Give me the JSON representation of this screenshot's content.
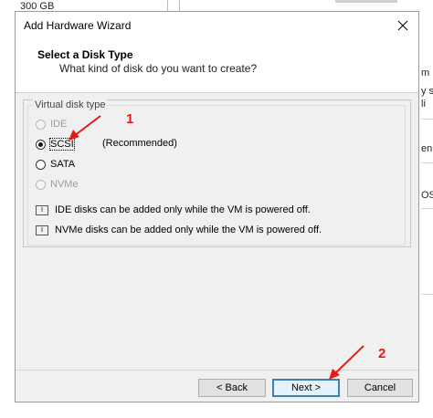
{
  "background": {
    "top_text": "300 GB",
    "right_fragments": [
      "m n",
      "y s",
      "li",
      "en",
      "OS n"
    ]
  },
  "dialog": {
    "title": "Add Hardware Wizard",
    "close_glyph": "✕",
    "header_title": "Select a Disk Type",
    "header_subtitle": "What kind of disk do you want to create?",
    "group_label": "Virtual disk type",
    "options": [
      {
        "label": "IDE",
        "enabled": false,
        "checked": false
      },
      {
        "label": "SCSI",
        "enabled": true,
        "checked": true,
        "note": "(Recommended)"
      },
      {
        "label": "SATA",
        "enabled": true,
        "checked": false
      },
      {
        "label": "NVMe",
        "enabled": false,
        "checked": false
      }
    ],
    "info_messages": [
      "IDE disks can be added only while the VM is powered off.",
      "NVMe disks can be added only while the VM is powered off."
    ],
    "buttons": {
      "back": "< Back",
      "next": "Next >",
      "cancel": "Cancel"
    }
  },
  "annotations": {
    "marker1": "1",
    "marker2": "2",
    "color": "#e41b17"
  }
}
